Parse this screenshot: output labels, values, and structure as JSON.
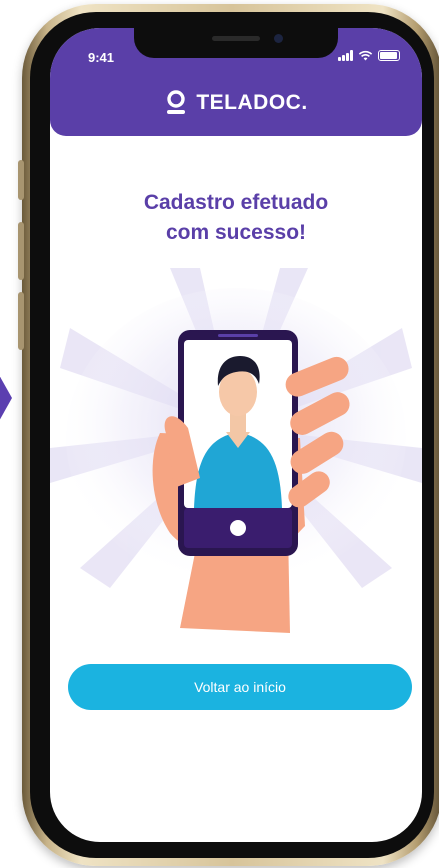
{
  "status_bar": {
    "time": "9:41",
    "icons": [
      "signal-icon",
      "wifi-icon",
      "battery-icon"
    ]
  },
  "header": {
    "logo_text": "TELADOC.",
    "logo_icon": "teladoc-logo-icon",
    "background_color": "#5a3fa8"
  },
  "main": {
    "title_line1": "Cadastro efetuado",
    "title_line2": "com sucesso!",
    "illustration": "hand-holding-phone-illustration"
  },
  "actions": {
    "back_button_label": "Voltar ao início",
    "button_color": "#1bb3e0"
  }
}
